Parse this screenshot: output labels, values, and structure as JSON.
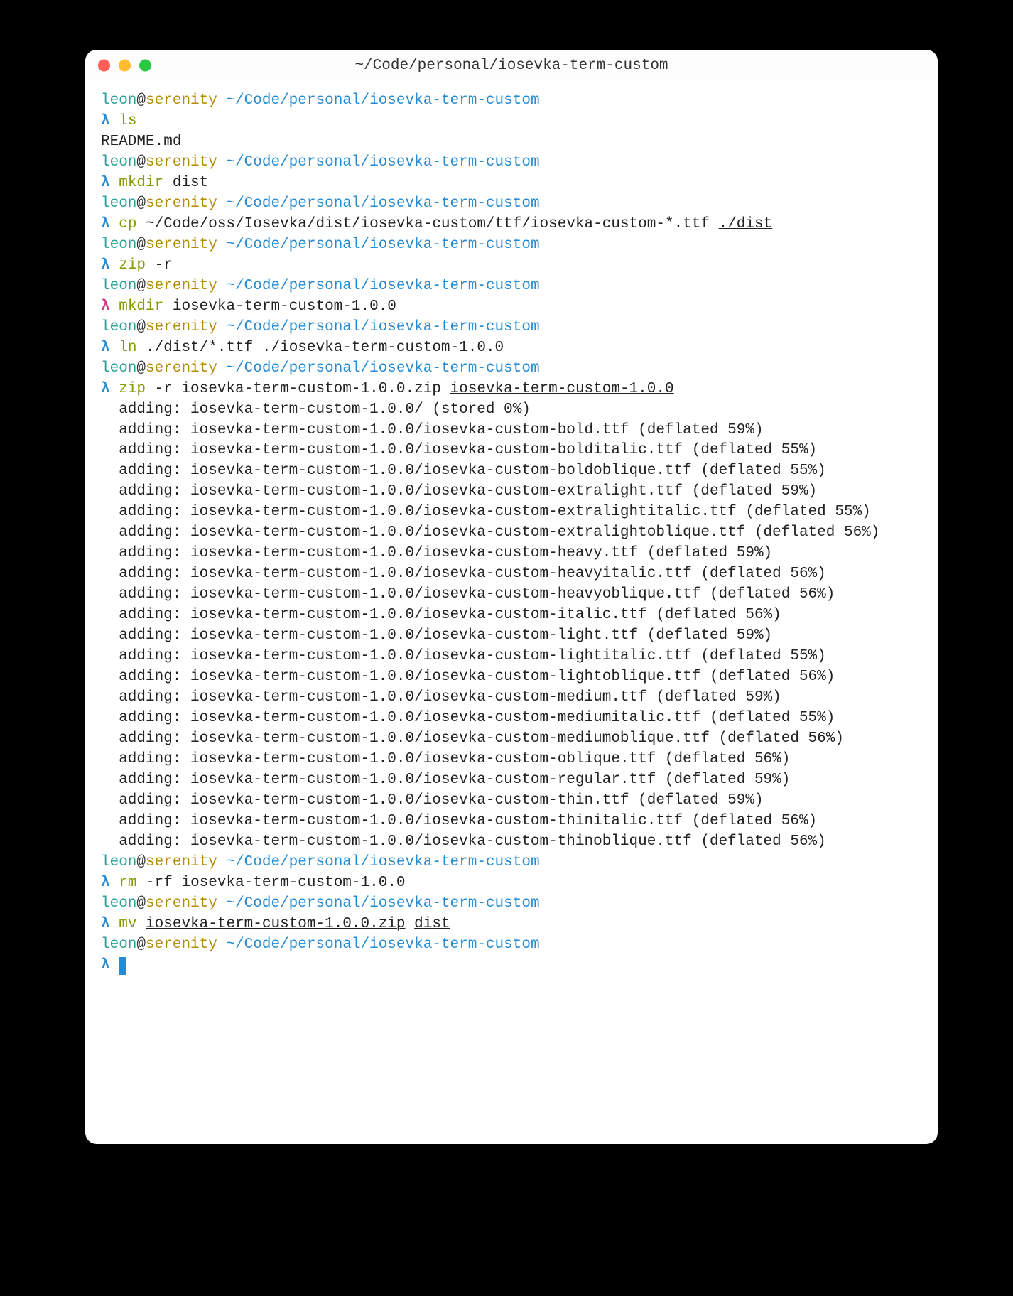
{
  "window": {
    "title": "~/Code/personal/iosevka-term-custom"
  },
  "prompt": {
    "user": "leon",
    "at": "@",
    "host": "serenity",
    "cwd": "~/Code/personal/iosevka-term-custom",
    "lambda": "λ"
  },
  "session": [
    {
      "type": "prompt"
    },
    {
      "type": "cmd",
      "cmd": "ls"
    },
    {
      "type": "out",
      "text": "README.md"
    },
    {
      "type": "prompt"
    },
    {
      "type": "cmd",
      "cmd": "mkdir",
      "args": "dist"
    },
    {
      "type": "prompt"
    },
    {
      "type": "cmd",
      "cmd": "cp",
      "args": "~/Code/oss/Iosevka/dist/iosevka-custom/ttf/iosevka-custom-*.ttf",
      "ul_trail": "./dist"
    },
    {
      "type": "prompt"
    },
    {
      "type": "cmd",
      "cmd": "zip",
      "args": "-r"
    },
    {
      "type": "prompt"
    },
    {
      "type": "cmd",
      "err": true,
      "cmd": "mkdir",
      "args": "iosevka-term-custom-1.0.0"
    },
    {
      "type": "prompt"
    },
    {
      "type": "cmd",
      "cmd": "ln",
      "args": "./dist/*.ttf",
      "ul_trail": "./iosevka-term-custom-1.0.0"
    },
    {
      "type": "prompt"
    },
    {
      "type": "cmd",
      "cmd": "zip",
      "args": "-r iosevka-term-custom-1.0.0.zip",
      "ul_trail": "iosevka-term-custom-1.0.0"
    },
    {
      "type": "out",
      "text": "  adding: iosevka-term-custom-1.0.0/ (stored 0%)"
    },
    {
      "type": "out",
      "text": "  adding: iosevka-term-custom-1.0.0/iosevka-custom-bold.ttf (deflated 59%)"
    },
    {
      "type": "out",
      "text": "  adding: iosevka-term-custom-1.0.0/iosevka-custom-bolditalic.ttf (deflated 55%)"
    },
    {
      "type": "out",
      "text": "  adding: iosevka-term-custom-1.0.0/iosevka-custom-boldoblique.ttf (deflated 55%)"
    },
    {
      "type": "out",
      "text": "  adding: iosevka-term-custom-1.0.0/iosevka-custom-extralight.ttf (deflated 59%)"
    },
    {
      "type": "out",
      "text": "  adding: iosevka-term-custom-1.0.0/iosevka-custom-extralightitalic.ttf (deflated 55%)"
    },
    {
      "type": "out",
      "text": "  adding: iosevka-term-custom-1.0.0/iosevka-custom-extralightoblique.ttf (deflated 56%)"
    },
    {
      "type": "out",
      "text": "  adding: iosevka-term-custom-1.0.0/iosevka-custom-heavy.ttf (deflated 59%)"
    },
    {
      "type": "out",
      "text": "  adding: iosevka-term-custom-1.0.0/iosevka-custom-heavyitalic.ttf (deflated 56%)"
    },
    {
      "type": "out",
      "text": "  adding: iosevka-term-custom-1.0.0/iosevka-custom-heavyoblique.ttf (deflated 56%)"
    },
    {
      "type": "out",
      "text": "  adding: iosevka-term-custom-1.0.0/iosevka-custom-italic.ttf (deflated 56%)"
    },
    {
      "type": "out",
      "text": "  adding: iosevka-term-custom-1.0.0/iosevka-custom-light.ttf (deflated 59%)"
    },
    {
      "type": "out",
      "text": "  adding: iosevka-term-custom-1.0.0/iosevka-custom-lightitalic.ttf (deflated 55%)"
    },
    {
      "type": "out",
      "text": "  adding: iosevka-term-custom-1.0.0/iosevka-custom-lightoblique.ttf (deflated 56%)"
    },
    {
      "type": "out",
      "text": "  adding: iosevka-term-custom-1.0.0/iosevka-custom-medium.ttf (deflated 59%)"
    },
    {
      "type": "out",
      "text": "  adding: iosevka-term-custom-1.0.0/iosevka-custom-mediumitalic.ttf (deflated 55%)"
    },
    {
      "type": "out",
      "text": "  adding: iosevka-term-custom-1.0.0/iosevka-custom-mediumoblique.ttf (deflated 56%)"
    },
    {
      "type": "out",
      "text": "  adding: iosevka-term-custom-1.0.0/iosevka-custom-oblique.ttf (deflated 56%)"
    },
    {
      "type": "out",
      "text": "  adding: iosevka-term-custom-1.0.0/iosevka-custom-regular.ttf (deflated 59%)"
    },
    {
      "type": "out",
      "text": "  adding: iosevka-term-custom-1.0.0/iosevka-custom-thin.ttf (deflated 59%)"
    },
    {
      "type": "out",
      "text": "  adding: iosevka-term-custom-1.0.0/iosevka-custom-thinitalic.ttf (deflated 56%)"
    },
    {
      "type": "out",
      "text": "  adding: iosevka-term-custom-1.0.0/iosevka-custom-thinoblique.ttf (deflated 56%)"
    },
    {
      "type": "prompt"
    },
    {
      "type": "cmd",
      "cmd": "rm",
      "args": "-rf",
      "ul_trail": "iosevka-term-custom-1.0.0"
    },
    {
      "type": "prompt"
    },
    {
      "type": "cmd",
      "cmd": "mv",
      "ul_args": [
        "iosevka-term-custom-1.0.0.zip",
        "dist"
      ]
    },
    {
      "type": "prompt"
    },
    {
      "type": "cursor"
    }
  ]
}
